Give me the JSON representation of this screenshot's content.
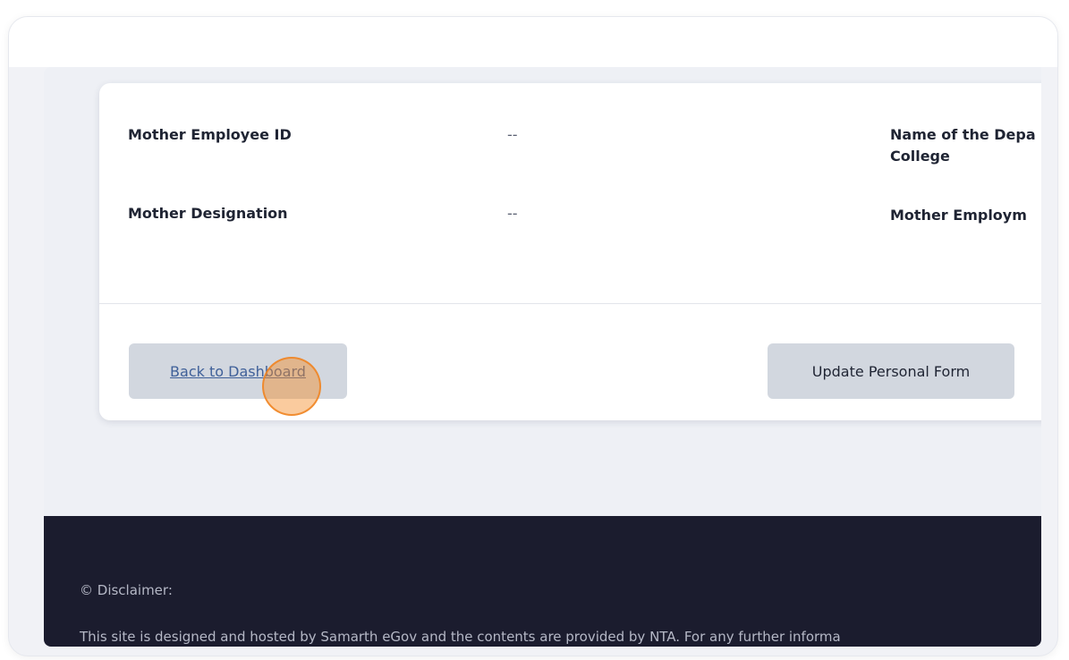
{
  "details": {
    "mother_employee_id_label": "Mother Employee ID",
    "mother_employee_id_value": "--",
    "name_of_department_label": "Name of the Depa",
    "name_of_department_label_line2": "College",
    "mother_designation_label": "Mother Designation",
    "mother_designation_value": "--",
    "mother_employment_label": "Mother Employm"
  },
  "actions": {
    "back_label": "Back to Dashboard",
    "update_label": "Update Personal Form"
  },
  "footer": {
    "disclaimer_title": "© Disclaimer:",
    "disclaimer_text": "This site is designed and hosted by Samarth eGov and the contents are provided by NTA. For any further informa"
  },
  "colors": {
    "footer_bg": "#1b1c2e",
    "button_bg": "#d2d7df",
    "link_color": "#3f6099",
    "marker": "#f58c28"
  }
}
